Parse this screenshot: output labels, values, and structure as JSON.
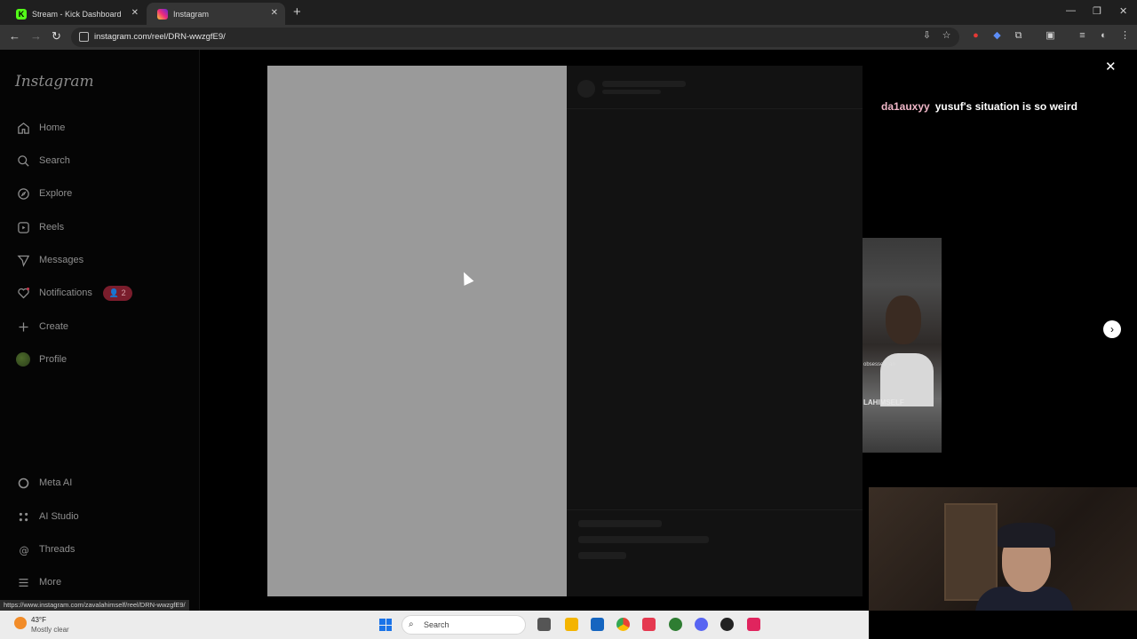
{
  "browser": {
    "tabs": [
      {
        "title": "Stream - Kick Dashboard",
        "active": false
      },
      {
        "title": "Instagram",
        "active": true
      }
    ],
    "url": "instagram.com/reel/DRN-wwzgfE9/",
    "status_url": "https://www.instagram.com/zavalahimself/reel/DRN-wwzgfE9/"
  },
  "instagram": {
    "logo": "Instagram",
    "nav": [
      {
        "label": "Home",
        "icon": "home-icon"
      },
      {
        "label": "Search",
        "icon": "search-icon"
      },
      {
        "label": "Explore",
        "icon": "compass-icon"
      },
      {
        "label": "Reels",
        "icon": "reels-icon"
      },
      {
        "label": "Messages",
        "icon": "messenger-icon"
      },
      {
        "label": "Notifications",
        "icon": "heart-icon",
        "badge": "2"
      },
      {
        "label": "Create",
        "icon": "plus-icon"
      },
      {
        "label": "Profile",
        "icon": "avatar"
      }
    ],
    "nav_bottom": [
      {
        "label": "Meta AI",
        "icon": "meta-ai-icon"
      },
      {
        "label": "AI Studio",
        "icon": "ai-studio-icon"
      },
      {
        "label": "Threads",
        "icon": "threads-icon"
      },
      {
        "label": "More",
        "icon": "menu-icon"
      }
    ]
  },
  "overlay": {
    "comment_user": "da1auxyy",
    "comment_text": "yusuf's situation is so weird",
    "thumbnail_label": "LAHIMSELF",
    "thumbnail_caption": "obsessed_an"
  },
  "taskbar": {
    "temperature": "43°F",
    "weather": "Mostly clear",
    "search_label": "Search"
  }
}
